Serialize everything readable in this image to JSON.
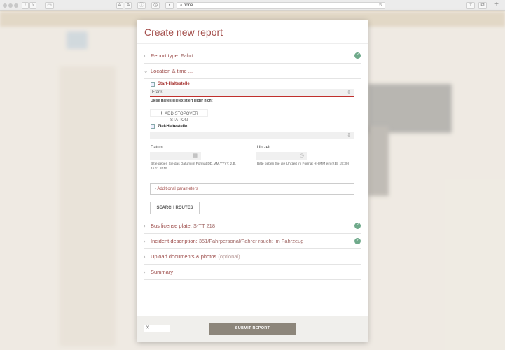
{
  "browser": {
    "url": "none"
  },
  "modal": {
    "title": "Create new report",
    "sections": {
      "report_type": {
        "label": "Report type:",
        "value": "Fahrt"
      },
      "location": {
        "label": "Location & time ..."
      },
      "bus": {
        "label": "Bus license plate:",
        "value": "S-TT 218"
      },
      "incident": {
        "label": "Incident description:",
        "value": "351/Fahrpersonal/Fahrer raucht im Fahrzeug"
      },
      "upload": {
        "label": "Upload documents & photos",
        "optional": "(optional)"
      },
      "summary": {
        "label": "Summary"
      }
    },
    "location": {
      "start_label": "Start-Haltestelle",
      "start_value": "Frank",
      "start_error": "Diese Haltestelle existiert leider nicht",
      "add_stopover": "ADD STOPOVER STATION",
      "end_label": "Ziel-Haltestelle",
      "end_value": "",
      "date_label": "Datum",
      "date_hint": "Bitte geben Sie das Datum im Format DD.MM.YYYY, z.B. 15.11.2019",
      "time_label": "Uhrzeit",
      "time_hint": "Bitte geben Sie die Uhrzeit im Format HH:MM ein (z.B. 15:30)",
      "additional": "Additional parameters",
      "search": "SEARCH ROUTES"
    },
    "footer": {
      "close": "✕",
      "submit": "SUBMIT REPORT"
    }
  }
}
